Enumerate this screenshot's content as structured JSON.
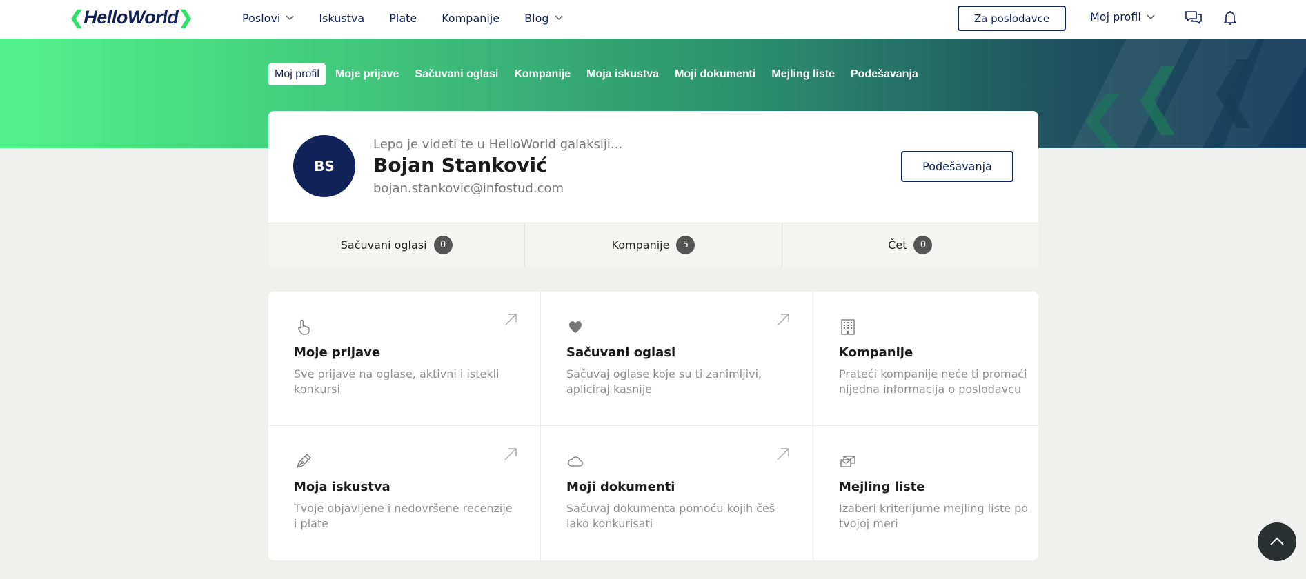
{
  "brand": {
    "logo_text": "HelloWorld",
    "accent": "#2ee06a",
    "primary": "#12235a"
  },
  "topnav": {
    "items": [
      {
        "label": "Poslovi",
        "has_dropdown": true
      },
      {
        "label": "Iskustva",
        "has_dropdown": false
      },
      {
        "label": "Plate",
        "has_dropdown": false
      },
      {
        "label": "Kompanije",
        "has_dropdown": false
      },
      {
        "label": "Blog",
        "has_dropdown": true
      }
    ],
    "employer_button": "Za poslodavce",
    "profile_menu": "Moj profil",
    "chat_icon": "chat-bubbles-icon",
    "notifications_icon": "bell-icon"
  },
  "subnav": {
    "items": [
      {
        "label": "Moj profil",
        "active": true
      },
      {
        "label": "Moje prijave",
        "active": false
      },
      {
        "label": "Sačuvani oglasi",
        "active": false
      },
      {
        "label": "Kompanije",
        "active": false
      },
      {
        "label": "Moja iskustva",
        "active": false
      },
      {
        "label": "Moji dokumenti",
        "active": false
      },
      {
        "label": "Mejling liste",
        "active": false
      },
      {
        "label": "Podešavanja",
        "active": false
      }
    ]
  },
  "profile": {
    "initials": "BS",
    "greeting": "Lepo je videti te u HelloWorld galaksiji...",
    "name": "Bojan Stanković",
    "email": "bojan.stankovic@infostud.com",
    "settings_button": "Podešavanja"
  },
  "stats": [
    {
      "label": "Sačuvani oglasi",
      "count": "0"
    },
    {
      "label": "Kompanije",
      "count": "5"
    },
    {
      "label": "Čet",
      "count": "0"
    }
  ],
  "tiles": [
    {
      "icon": "pointing-hand-icon",
      "title": "Moje prijave",
      "description": "Sve prijave na oglase, aktivni i istekli konkursi"
    },
    {
      "icon": "heart-icon",
      "title": "Sačuvani oglasi",
      "description": "Sačuvaj oglase koje su ti zanimljivi, apliciraj kasnije"
    },
    {
      "icon": "building-icon",
      "title": "Kompanije",
      "description": "Prateći kompanije neće ti promaći nijedna informacija o poslodavcu"
    },
    {
      "icon": "pen-icon",
      "title": "Moja iskustva",
      "description": "Tvoje objavljene i nedovršene recenzije i plate"
    },
    {
      "icon": "cloud-icon",
      "title": "Moji dokumenti",
      "description": "Sačuvaj dokumenta pomoću kojih češ lako konkurisati"
    },
    {
      "icon": "mail-stack-icon",
      "title": "Mejling liste",
      "description": "Izaberi kriterijume mejling liste po tvojoj meri"
    }
  ],
  "scroll_top_icon": "chevron-up-icon"
}
